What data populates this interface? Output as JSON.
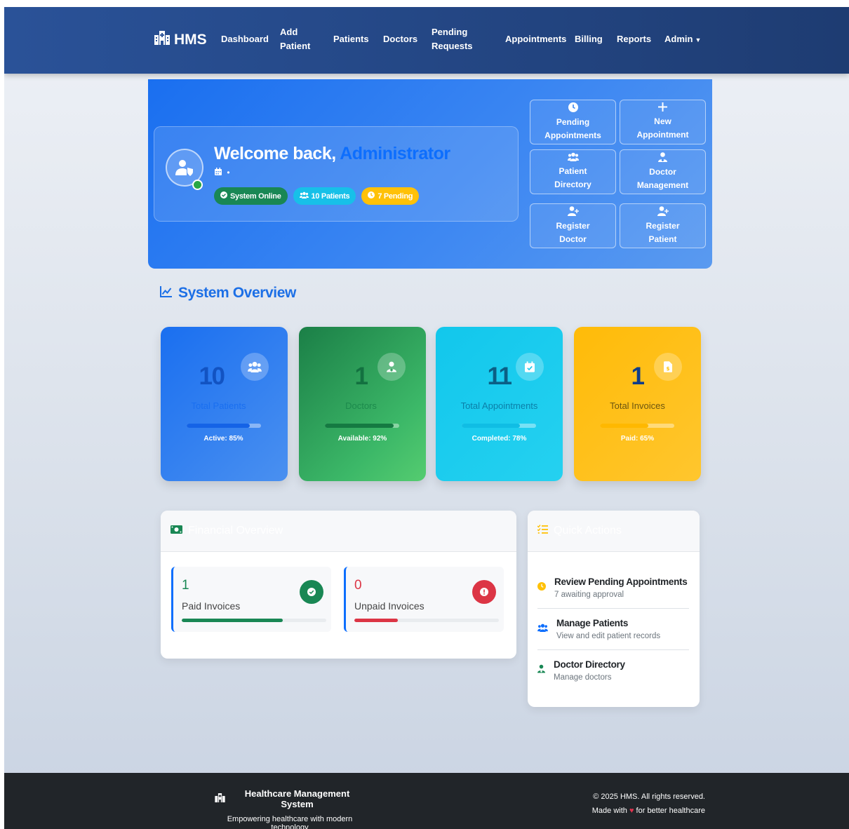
{
  "navbar": {
    "brand": "HMS",
    "links": {
      "dashboard": "Dashboard",
      "add_patient": "Add Patient",
      "patients": "Patients",
      "doctors": "Doctors",
      "pending_requests": "Pending Requests",
      "appointments": "Appointments",
      "billing": "Billing",
      "reports": "Reports",
      "admin": "Admin"
    }
  },
  "hero": {
    "welcome_prefix": "Welcome back, ",
    "user_name": "Administrator",
    "date_text": "•",
    "badges": {
      "status": "System Online",
      "patients": "10 Patients",
      "pending": "7 Pending"
    },
    "quick_buttons": [
      {
        "icon": "clock-icon",
        "label": "Pending Appointments"
      },
      {
        "icon": "plus-icon",
        "label": "New Appointment"
      },
      {
        "icon": "users-icon",
        "label": "Patient Directory"
      },
      {
        "icon": "doctor-icon",
        "label": "Doctor Management"
      },
      {
        "icon": "user-plus-icon",
        "label": "Register Doctor"
      },
      {
        "icon": "user-plus-icon",
        "label": "Register Patient"
      }
    ]
  },
  "overview": {
    "title": "System Overview",
    "stats": [
      {
        "value": "10",
        "label": "Total Patients",
        "sub": "Active: 85%",
        "progress": 0.85,
        "icon": "users-icon"
      },
      {
        "value": "1",
        "label": "Doctors",
        "sub": "Available: 92%",
        "progress": 0.92,
        "icon": "doctor-icon"
      },
      {
        "value": "11",
        "label": "Total Appointments",
        "sub": "Completed: 78%",
        "progress": 0.78,
        "icon": "calendar-check-icon"
      },
      {
        "value": "1",
        "label": "Total Invoices",
        "sub": "Paid: 65%",
        "progress": 0.65,
        "icon": "invoice-icon"
      }
    ]
  },
  "financial": {
    "title": "Financial Overview",
    "paid": {
      "value": "1",
      "label": "Paid Invoices",
      "progress": 0.7
    },
    "unpaid": {
      "value": "0",
      "label": "Unpaid Invoices",
      "progress": 0.3
    }
  },
  "quick_actions": {
    "title": "Quick Actions",
    "items": [
      {
        "title": "Review Pending Appointments",
        "sub": "7 awaiting approval",
        "icon": "clock-icon"
      },
      {
        "title": "Manage Patients",
        "sub": "View and edit patient records",
        "icon": "users-icon"
      },
      {
        "title": "Doctor Directory",
        "sub": "Manage doctors",
        "icon": "doctor-icon"
      }
    ]
  },
  "footer": {
    "title": "Healthcare Management System",
    "tagline": "Empowering healthcare with modern technology",
    "copyright": "© 2025 HMS. All rights reserved.",
    "made_with_prefix": "Made with",
    "made_with_suffix": "for better healthcare"
  },
  "colors": {
    "nav_start": "#2a5298",
    "nav_end": "#1e3c72",
    "primary": "#0d6efd",
    "success": "#198754",
    "info": "#17c0e8",
    "warning": "#ffc107",
    "danger": "#dc3545"
  }
}
